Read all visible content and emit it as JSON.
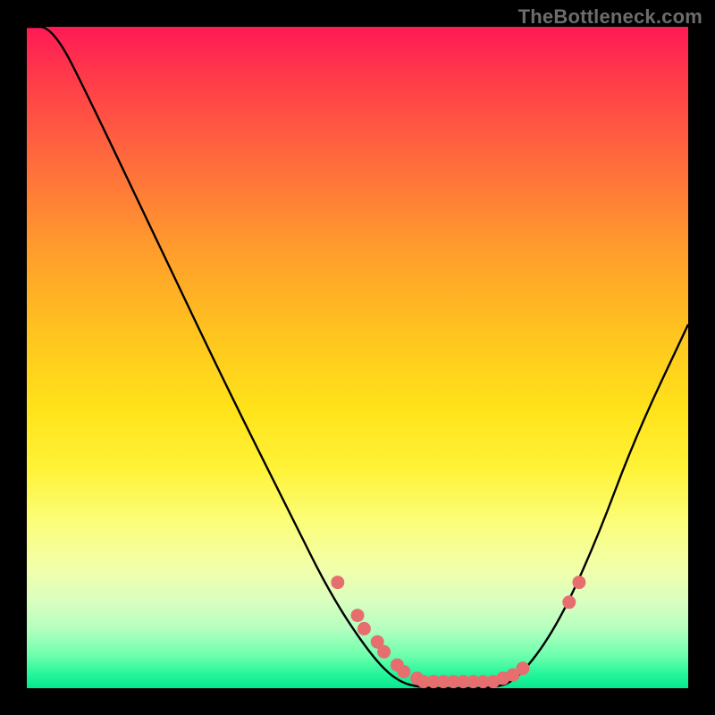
{
  "attribution": "TheBottleneck.com",
  "chart_data": {
    "type": "line",
    "title": "",
    "xlabel": "",
    "ylabel": "",
    "xlim": [
      0,
      100
    ],
    "ylim": [
      0,
      100
    ],
    "curve": [
      {
        "x": 0,
        "y": 100
      },
      {
        "x": 4,
        "y": 100
      },
      {
        "x": 10,
        "y": 88
      },
      {
        "x": 20,
        "y": 67
      },
      {
        "x": 30,
        "y": 46
      },
      {
        "x": 40,
        "y": 26
      },
      {
        "x": 46,
        "y": 14
      },
      {
        "x": 52,
        "y": 5
      },
      {
        "x": 56,
        "y": 1
      },
      {
        "x": 60,
        "y": 0
      },
      {
        "x": 65,
        "y": 0
      },
      {
        "x": 70,
        "y": 0
      },
      {
        "x": 74,
        "y": 1
      },
      {
        "x": 80,
        "y": 9
      },
      {
        "x": 86,
        "y": 22
      },
      {
        "x": 92,
        "y": 38
      },
      {
        "x": 100,
        "y": 55
      }
    ],
    "dots": [
      {
        "x": 47,
        "y": 16
      },
      {
        "x": 50,
        "y": 11
      },
      {
        "x": 51,
        "y": 9
      },
      {
        "x": 53,
        "y": 7
      },
      {
        "x": 54,
        "y": 5.5
      },
      {
        "x": 56,
        "y": 3.5
      },
      {
        "x": 57,
        "y": 2.5
      },
      {
        "x": 59,
        "y": 1.5
      },
      {
        "x": 60,
        "y": 1
      },
      {
        "x": 61.5,
        "y": 1
      },
      {
        "x": 63,
        "y": 1
      },
      {
        "x": 64.5,
        "y": 1
      },
      {
        "x": 66,
        "y": 1
      },
      {
        "x": 67.5,
        "y": 1
      },
      {
        "x": 69,
        "y": 1
      },
      {
        "x": 70.5,
        "y": 1
      },
      {
        "x": 72,
        "y": 1.5
      },
      {
        "x": 73.5,
        "y": 2
      },
      {
        "x": 75,
        "y": 3
      },
      {
        "x": 82,
        "y": 13
      },
      {
        "x": 83.5,
        "y": 16
      }
    ],
    "colors": {
      "curve": "#000000",
      "dots": "#e76e6e"
    }
  }
}
